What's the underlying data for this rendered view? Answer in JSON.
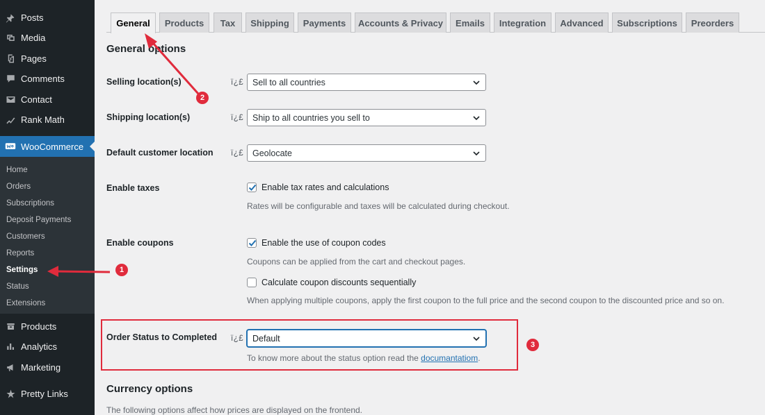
{
  "sidebar": {
    "top_items": [
      {
        "label": "Posts",
        "icon": "pin-icon"
      },
      {
        "label": "Media",
        "icon": "media-icon"
      },
      {
        "label": "Pages",
        "icon": "pages-icon"
      },
      {
        "label": "Comments",
        "icon": "comments-icon"
      },
      {
        "label": "Contact",
        "icon": "mail-icon"
      },
      {
        "label": "Rank Math",
        "icon": "rank-math-icon"
      }
    ],
    "woocommerce": {
      "label": "WooCommerce",
      "icon": "woocommerce-icon"
    },
    "submenu": [
      "Home",
      "Orders",
      "Subscriptions",
      "Deposit Payments",
      "Customers",
      "Reports",
      "Settings",
      "Status",
      "Extensions"
    ],
    "current_submenu": "Settings",
    "bottom_items": [
      {
        "label": "Products",
        "icon": "products-icon"
      },
      {
        "label": "Analytics",
        "icon": "analytics-icon"
      },
      {
        "label": "Marketing",
        "icon": "marketing-icon"
      },
      {
        "label": "Pretty Links",
        "icon": "star-icon"
      }
    ]
  },
  "tabs": [
    "General",
    "Products",
    "Tax",
    "Shipping",
    "Payments",
    "Accounts & Privacy",
    "Emails",
    "Integration",
    "Advanced",
    "Subscriptions",
    "Preorders"
  ],
  "active_tab": "General",
  "general": {
    "title": "General options",
    "help_glyph": "ï¿£",
    "selling_location": {
      "label": "Selling location(s)",
      "value": "Sell to all countries"
    },
    "shipping_location": {
      "label": "Shipping location(s)",
      "value": "Ship to all countries you sell to"
    },
    "default_customer_location": {
      "label": "Default customer location",
      "value": "Geolocate"
    },
    "enable_taxes": {
      "label": "Enable taxes",
      "checkbox_label": "Enable tax rates and calculations",
      "checked": true,
      "description": "Rates will be configurable and taxes will be calculated during checkout."
    },
    "enable_coupons": {
      "label": "Enable coupons",
      "checkbox_label": "Enable the use of coupon codes",
      "checked": true,
      "description": "Coupons can be applied from the cart and checkout pages.",
      "sequential_label": "Calculate coupon discounts sequentially",
      "sequential_checked": false,
      "sequential_description": "When applying multiple coupons, apply the first coupon to the full price and the second coupon to the discounted price and so on."
    },
    "order_status": {
      "label": "Order Status to Completed",
      "value": "Default",
      "description_prefix": "To know more about the status option read the ",
      "link_text": "documantatiom",
      "description_suffix": "."
    }
  },
  "currency": {
    "title": "Currency options",
    "description": "The following options affect how prices are displayed on the frontend."
  },
  "annotations": {
    "badge1": "1",
    "badge2": "2",
    "badge3": "3",
    "color": "#e02b3c"
  }
}
